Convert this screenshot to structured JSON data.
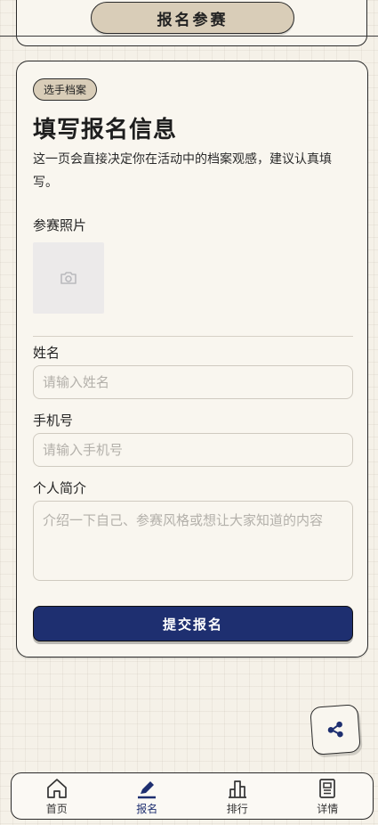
{
  "header": {
    "title": "报名参赛"
  },
  "card": {
    "badge": "选手档案",
    "heading": "填写报名信息",
    "description": "这一页会直接决定你在活动中的档案观感，建议认真填写。",
    "photo_label": "参赛照片",
    "photo_icon": "camera-icon",
    "name_label": "姓名",
    "name_placeholder": "请输入姓名",
    "name_value": "",
    "phone_label": "手机号",
    "phone_placeholder": "请输入手机号",
    "phone_value": "",
    "bio_label": "个人简介",
    "bio_placeholder": "介绍一下自己、参赛风格或想让大家知道的内容",
    "bio_value": "",
    "submit_label": "提交报名"
  },
  "share": {
    "icon": "share-icon"
  },
  "nav": {
    "items": [
      {
        "label": "首页",
        "icon": "home-icon",
        "active": false
      },
      {
        "label": "报名",
        "icon": "pen-icon",
        "active": true
      },
      {
        "label": "排行",
        "icon": "ranking-icon",
        "active": false
      },
      {
        "label": "详情",
        "icon": "document-icon",
        "active": false
      }
    ]
  },
  "colors": {
    "background": "#f5f1e8",
    "accent": "#1e2f70",
    "pill": "#d9cdb8",
    "card": "#f9f6ef"
  }
}
